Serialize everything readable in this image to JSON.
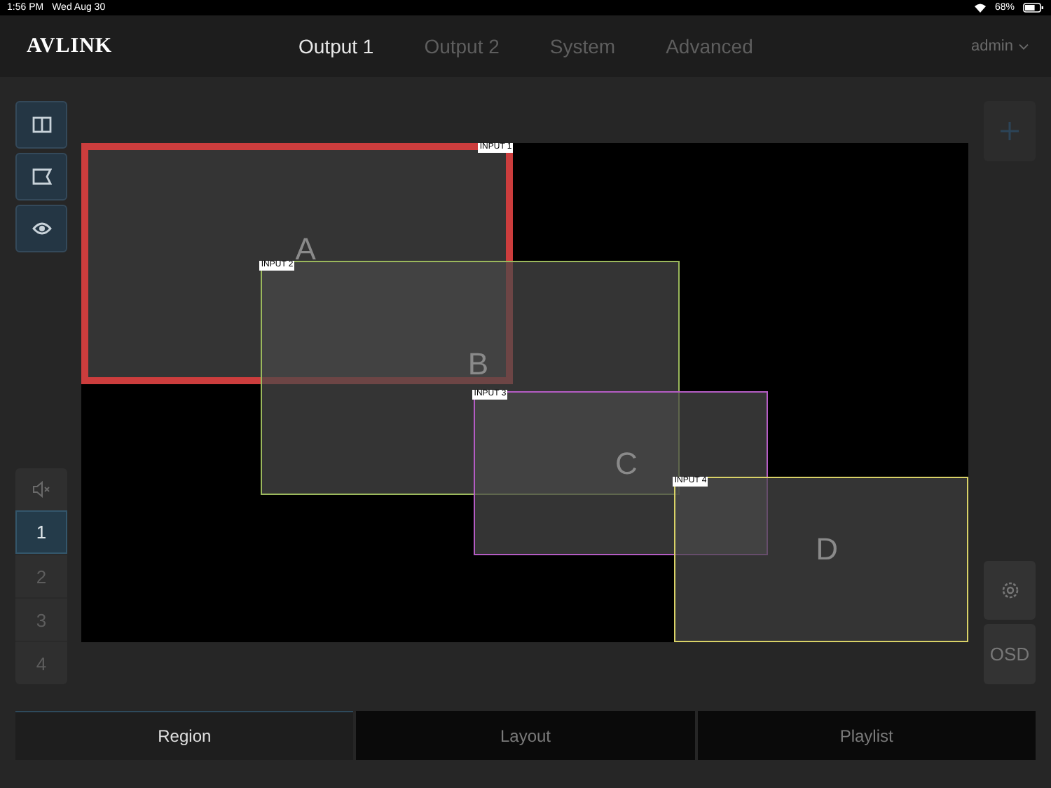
{
  "status_bar": {
    "time": "1:56 PM",
    "date": "Wed Aug 30",
    "battery": "68%"
  },
  "header": {
    "logo": "AVLINK",
    "user": "admin",
    "tabs": [
      {
        "label": "Output 1",
        "selected": true
      },
      {
        "label": "Output 2",
        "selected": false
      },
      {
        "label": "System",
        "selected": false
      },
      {
        "label": "Advanced",
        "selected": false
      }
    ]
  },
  "left_tools": [
    {
      "kind": "split"
    },
    {
      "kind": "tag"
    },
    {
      "kind": "eye"
    }
  ],
  "channels": [
    {
      "label": "1",
      "selected": true
    },
    {
      "label": "2",
      "selected": false
    },
    {
      "label": "3",
      "selected": false
    },
    {
      "label": "4",
      "selected": false
    }
  ],
  "regions": [
    {
      "letter": "A",
      "input": "INPUT 1",
      "color": "#cc3d3d",
      "selected": true
    },
    {
      "letter": "B",
      "input": "INPUT 2",
      "color": "#9bb85c",
      "selected": false
    },
    {
      "letter": "C",
      "input": "INPUT 3",
      "color": "#b45cc4",
      "selected": false
    },
    {
      "letter": "D",
      "input": "INPUT 4",
      "color": "#d9d267",
      "selected": false
    }
  ],
  "osd": "OSD",
  "bottom_tabs": [
    {
      "label": "Region",
      "selected": true
    },
    {
      "label": "Layout",
      "selected": false
    },
    {
      "label": "Playlist",
      "selected": false
    }
  ]
}
